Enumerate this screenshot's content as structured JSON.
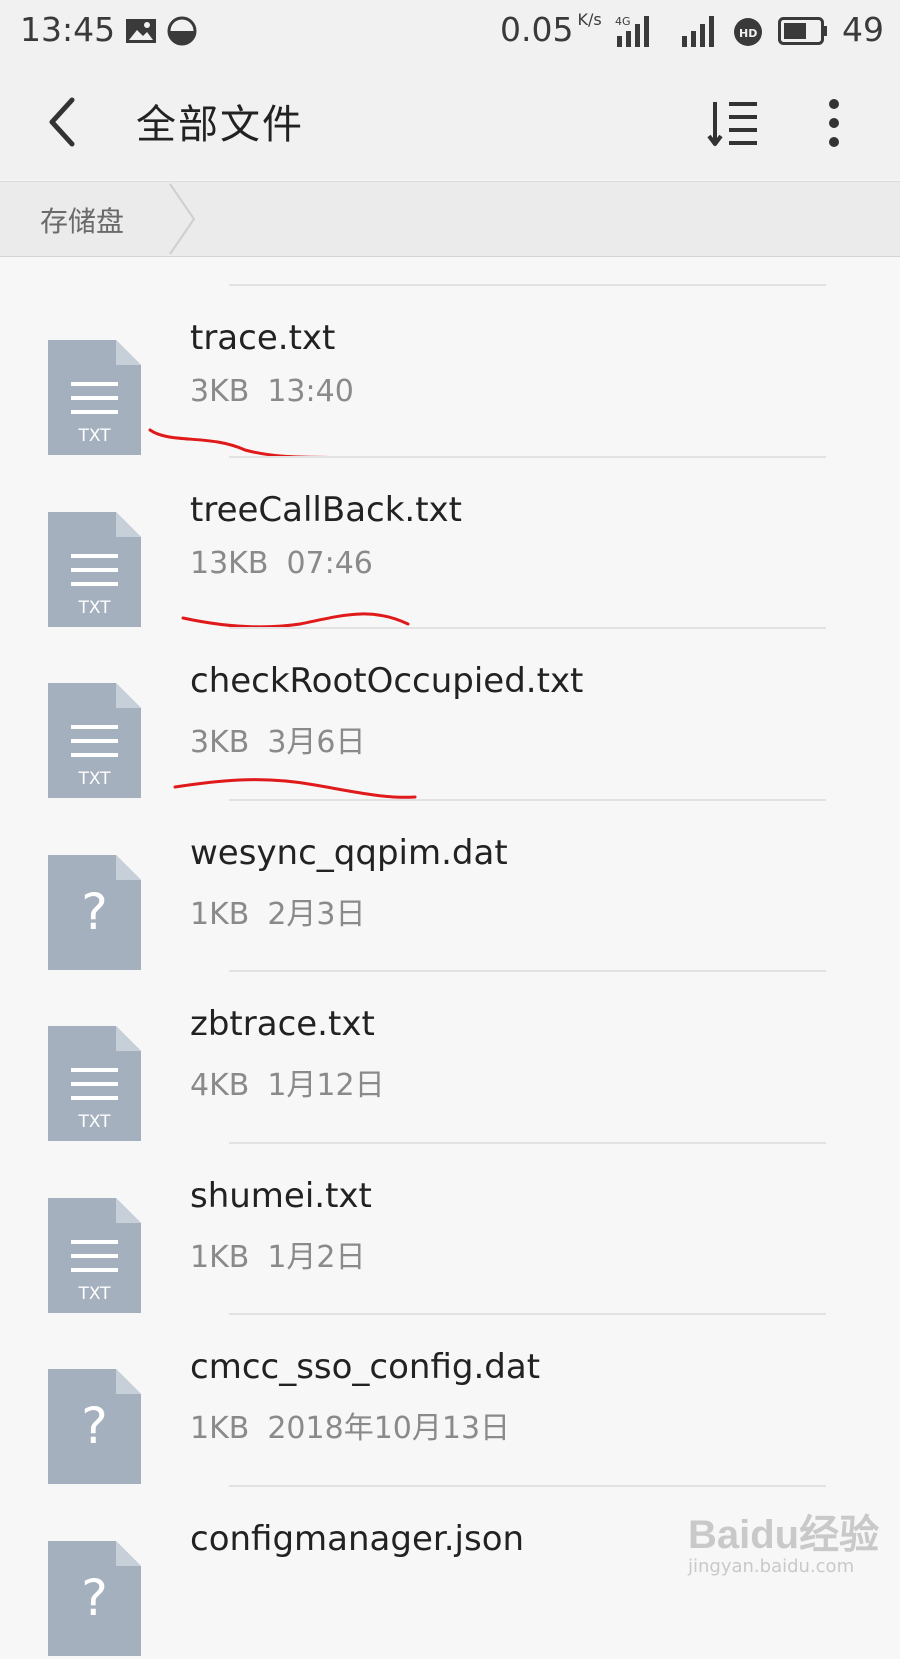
{
  "status_bar": {
    "time": "13:45",
    "speed": "0.05",
    "speed_unit": "K/s",
    "network_label": "4G",
    "battery_pct": "49",
    "icons": [
      "image-icon",
      "mode-icon",
      "signal-4g-icon",
      "signal-icon",
      "hd-icon",
      "battery-icon"
    ]
  },
  "header": {
    "title": "全部文件"
  },
  "breadcrumb": {
    "items": [
      {
        "label": "存储盘"
      }
    ]
  },
  "files": [
    {
      "name": "trace.txt",
      "size": "3KB",
      "date": "13:40",
      "type_label": "TXT",
      "icon": "txt-file-icon",
      "annotated": true
    },
    {
      "name": "treeCallBack.txt",
      "size": "13KB",
      "date": "07:46",
      "type_label": "TXT",
      "icon": "txt-file-icon",
      "annotated": true
    },
    {
      "name": "checkRootOccupied.txt",
      "size": "3KB",
      "date": "3月6日",
      "type_label": "TXT",
      "icon": "txt-file-icon",
      "annotated": true
    },
    {
      "name": "wesync_qqpim.dat",
      "size": "1KB",
      "date": "2月3日",
      "type_label": "?",
      "icon": "unknown-file-icon",
      "annotated": false
    },
    {
      "name": "zbtrace.txt",
      "size": "4KB",
      "date": "1月12日",
      "type_label": "TXT",
      "icon": "txt-file-icon",
      "annotated": false
    },
    {
      "name": "shumei.txt",
      "size": "1KB",
      "date": "1月2日",
      "type_label": "TXT",
      "icon": "txt-file-icon",
      "annotated": false
    },
    {
      "name": "cmcc_sso_config.dat",
      "size": "1KB",
      "date": "2018年10月13日",
      "type_label": "?",
      "icon": "unknown-file-icon",
      "annotated": false
    },
    {
      "name": "configmanager.json",
      "size": "",
      "date": "",
      "type_label": "?",
      "icon": "unknown-file-icon",
      "annotated": false
    }
  ],
  "watermark": {
    "logo": "Baidu经验",
    "url": "jingyan.baidu.com"
  },
  "colors": {
    "icon_fill": "#a4b0bd",
    "icon_fold": "#c7d0d9",
    "annotation": "#e0191b",
    "background": "#f7f7f7"
  }
}
